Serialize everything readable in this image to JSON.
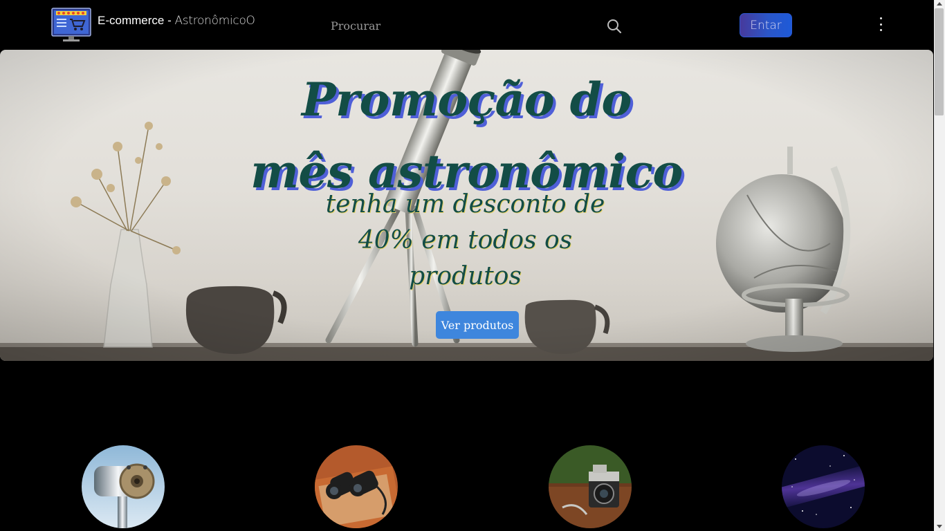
{
  "page_progress": 0.2,
  "header": {
    "logo_icon": "shop-cart-monitor-icon",
    "brand_part1": "E-commerce - ",
    "brand_part2": "AstronômicoO",
    "search_placeholder": "Procurar",
    "search_icon": "search-icon",
    "login_label": "Entar",
    "menu_icon": "kebab-menu-icon"
  },
  "hero": {
    "title_line1": "Promoção do",
    "title_line2": "mês astronômico",
    "subtitle": "tenha um desconto de 40% em todos os produtos",
    "cta_label": "Ver produtos"
  },
  "categories": [
    {
      "icon": "telescope-icon"
    },
    {
      "icon": "binoculars-icon"
    },
    {
      "icon": "camera-icon"
    },
    {
      "icon": "galaxy-icon"
    }
  ],
  "colors": {
    "accent_button": "#3e86dd",
    "title_text": "#134d46",
    "title_shadow": "#4f5fd8",
    "login_gradient_start": "#473a9c",
    "login_gradient_end": "#1e5ad8"
  }
}
